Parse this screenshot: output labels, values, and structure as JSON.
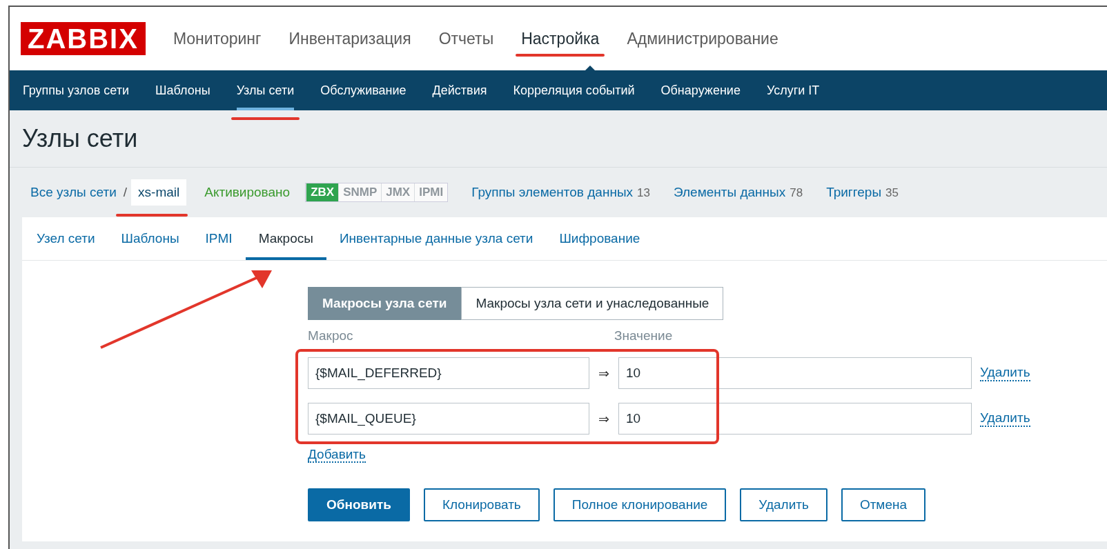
{
  "logo": {
    "text": "ZABBIX"
  },
  "main_menu": [
    {
      "label": "Мониторинг",
      "selected": false,
      "annotated": false
    },
    {
      "label": "Инвентаризация",
      "selected": false,
      "annotated": false
    },
    {
      "label": "Отчеты",
      "selected": false,
      "annotated": false
    },
    {
      "label": "Настройка",
      "selected": true,
      "annotated": true
    },
    {
      "label": "Администрирование",
      "selected": false,
      "annotated": false
    }
  ],
  "sub_menu": [
    {
      "label": "Группы узлов сети",
      "selected": false,
      "annotated": false
    },
    {
      "label": "Шаблоны",
      "selected": false,
      "annotated": false
    },
    {
      "label": "Узлы сети",
      "selected": true,
      "annotated": true
    },
    {
      "label": "Обслуживание",
      "selected": false,
      "annotated": false
    },
    {
      "label": "Действия",
      "selected": false,
      "annotated": false
    },
    {
      "label": "Корреляция событий",
      "selected": false,
      "annotated": false
    },
    {
      "label": "Обнаружение",
      "selected": false,
      "annotated": false
    },
    {
      "label": "Услуги IT",
      "selected": false,
      "annotated": false
    }
  ],
  "page_title": "Узлы сети",
  "host_bar": {
    "all_hosts": "Все узлы сети",
    "separator": "/",
    "host": "xs-mail",
    "host_annotated": true,
    "status": "Активировано",
    "availability": [
      {
        "label": "ZBX",
        "active": true
      },
      {
        "label": "SNMP",
        "active": false
      },
      {
        "label": "JMX",
        "active": false
      },
      {
        "label": "IPMI",
        "active": false
      }
    ],
    "links": [
      {
        "label": "Группы элементов данных",
        "count": "13"
      },
      {
        "label": "Элементы данных",
        "count": "78"
      },
      {
        "label": "Триггеры",
        "count": "35"
      }
    ]
  },
  "tabs": [
    {
      "label": "Узел сети",
      "selected": false
    },
    {
      "label": "Шаблоны",
      "selected": false
    },
    {
      "label": "IPMI",
      "selected": false
    },
    {
      "label": "Макросы",
      "selected": true
    },
    {
      "label": "Инвентарные данные узла сети",
      "selected": false
    },
    {
      "label": "Шифрование",
      "selected": false
    }
  ],
  "macro_mode": [
    {
      "label": "Макросы узла сети",
      "selected": true
    },
    {
      "label": "Макросы узла сети и унаследованные",
      "selected": false
    }
  ],
  "columns": [
    "Макрос",
    "Значение"
  ],
  "macros": [
    {
      "macro": "{$MAIL_DEFERRED}",
      "arrow": "⇒",
      "value": "10",
      "remove": "Удалить"
    },
    {
      "macro": "{$MAIL_QUEUE}",
      "arrow": "⇒",
      "value": "10",
      "remove": "Удалить"
    }
  ],
  "add_link": "Добавить",
  "buttons": [
    {
      "label": "Обновить",
      "kind": "primary"
    },
    {
      "label": "Клонировать",
      "kind": "secondary"
    },
    {
      "label": "Полное клонирование",
      "kind": "secondary"
    },
    {
      "label": "Удалить",
      "kind": "secondary"
    },
    {
      "label": "Отмена",
      "kind": "secondary"
    }
  ]
}
